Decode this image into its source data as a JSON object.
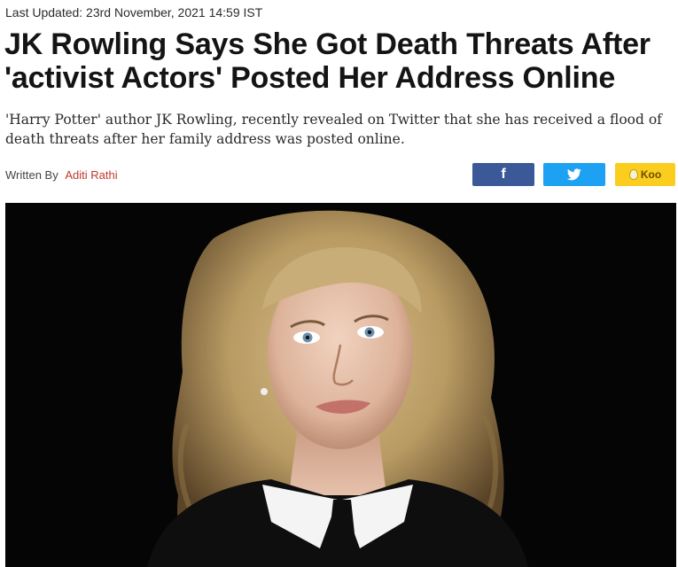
{
  "article": {
    "last_updated": "Last Updated: 23rd November, 2021 14:59 IST",
    "headline_lines": [
      "JK Rowling Says She Got Death Threats After",
      "'activist Actors' Posted Her Address Online"
    ],
    "summary_lines": [
      "'Harry Potter' author JK Rowling, recently revealed on Twitter that she has received a flood of",
      "death threats after her family address was posted online."
    ],
    "byline_prefix": "Written By",
    "author": "Aditi Rathi"
  },
  "share": {
    "facebook": {
      "label": "f",
      "icon": "facebook-icon",
      "color": "#3b5998"
    },
    "twitter": {
      "icon": "twitter-bird-icon",
      "color": "#1da1f2"
    },
    "koo": {
      "label": "Koo",
      "icon": "koo-icon",
      "color": "#facd1e"
    }
  },
  "colors": {
    "headline": "#141414",
    "author_link": "#c0392b",
    "photo_background": "#050505"
  }
}
